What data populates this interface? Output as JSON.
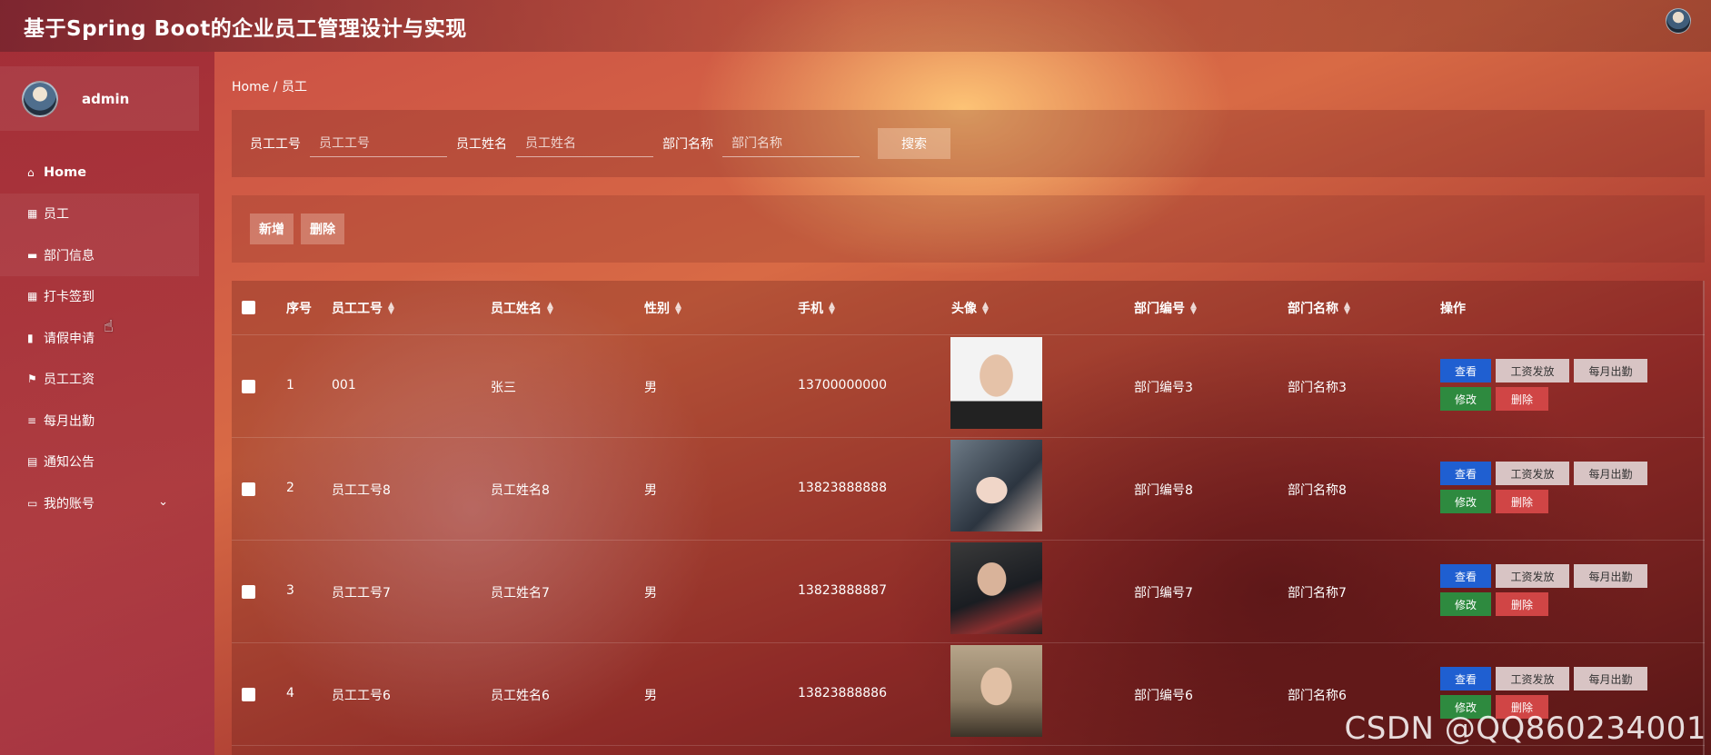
{
  "app": {
    "title": "基于Spring Boot的企业员工管理设计与实现"
  },
  "user": {
    "name": "admin"
  },
  "sidebar": {
    "items": [
      {
        "label": "Home",
        "icon": "home-icon"
      },
      {
        "label": "员工",
        "icon": "grid-icon"
      },
      {
        "label": "部门信息",
        "icon": "comment-icon"
      },
      {
        "label": "打卡签到",
        "icon": "apps-icon"
      },
      {
        "label": "请假申请",
        "icon": "chart-icon"
      },
      {
        "label": "员工工资",
        "icon": "flag-icon"
      },
      {
        "label": "每月出勤",
        "icon": "sliders-icon"
      },
      {
        "label": "通知公告",
        "icon": "clipboard-icon"
      },
      {
        "label": "我的账号",
        "icon": "window-icon"
      }
    ]
  },
  "breadcrumb": "Home / 员工",
  "search": {
    "fields": [
      {
        "label": "员工工号",
        "placeholder": "员工工号"
      },
      {
        "label": "员工姓名",
        "placeholder": "员工姓名"
      },
      {
        "label": "部门名称",
        "placeholder": "部门名称"
      }
    ],
    "button": "搜索"
  },
  "actions": {
    "add": "新增",
    "delete": "删除"
  },
  "table": {
    "headers": [
      "序号",
      "员工工号",
      "员工姓名",
      "性别",
      "手机",
      "头像",
      "部门编号",
      "部门名称",
      "操作"
    ],
    "ops": {
      "view": "查看",
      "salary": "工资发放",
      "monthly": "每月出勤",
      "edit": "修改",
      "delete": "删除"
    },
    "rows": [
      {
        "index": "1",
        "emp_no": "001",
        "name": "张三",
        "gender": "男",
        "phone": "13700000000",
        "dept_no": "部门编号3",
        "dept_name": "部门名称3"
      },
      {
        "index": "2",
        "emp_no": "员工工号8",
        "name": "员工姓名8",
        "gender": "男",
        "phone": "13823888888",
        "dept_no": "部门编号8",
        "dept_name": "部门名称8"
      },
      {
        "index": "3",
        "emp_no": "员工工号7",
        "name": "员工姓名7",
        "gender": "男",
        "phone": "13823888887",
        "dept_no": "部门编号7",
        "dept_name": "部门名称7"
      },
      {
        "index": "4",
        "emp_no": "员工工号6",
        "name": "员工姓名6",
        "gender": "男",
        "phone": "13823888886",
        "dept_no": "部门编号6",
        "dept_name": "部门名称6"
      }
    ]
  },
  "watermark": "CSDN @QQ860234001"
}
